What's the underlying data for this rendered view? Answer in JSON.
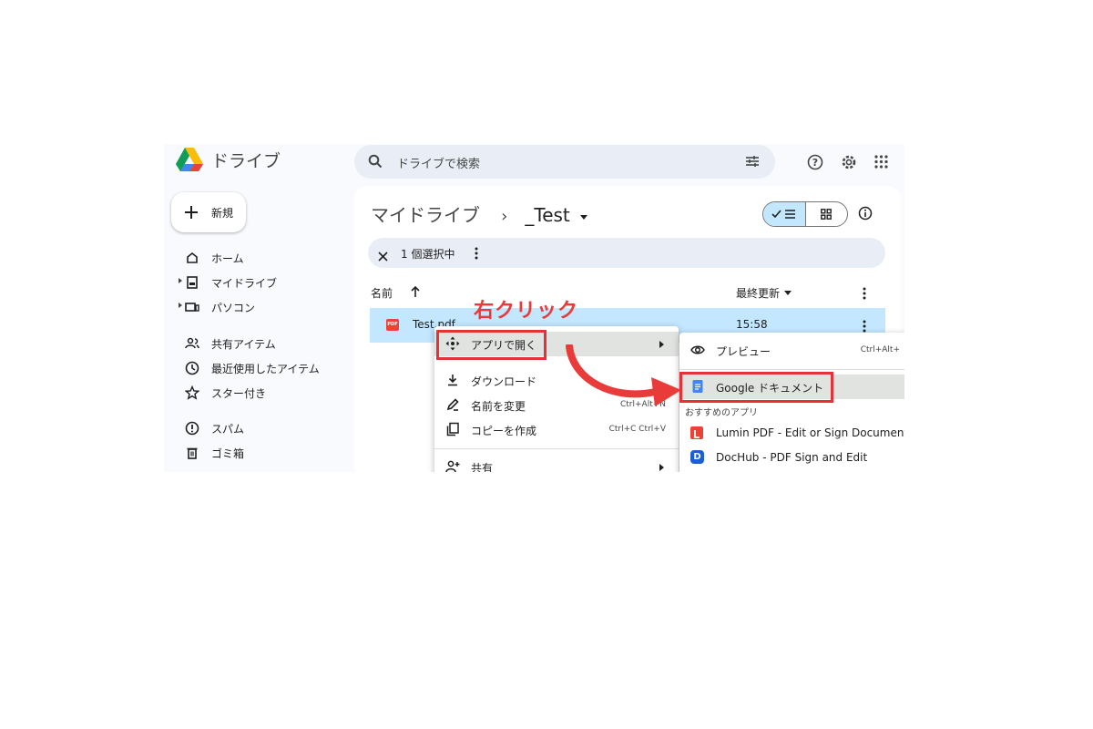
{
  "header": {
    "app_name": "ドライブ",
    "search_placeholder": "ドライブで検索"
  },
  "sidebar": {
    "new_label": "新規",
    "items": [
      {
        "label": "ホーム"
      },
      {
        "label": "マイドライブ"
      },
      {
        "label": "パソコン"
      },
      {
        "label": "共有アイテム"
      },
      {
        "label": "最近使用したアイテム"
      },
      {
        "label": "スター付き"
      },
      {
        "label": "スパム"
      },
      {
        "label": "ゴミ箱"
      }
    ]
  },
  "breadcrumb": {
    "root": "マイドライブ",
    "separator": "›",
    "current": "_Test"
  },
  "selection_bar": {
    "text": "1 個選択中"
  },
  "file_list": {
    "col_name": "名前",
    "col_modified": "最終更新",
    "rows": [
      {
        "name": "Test.pdf",
        "modified": "15:58",
        "type_badge": "PDF"
      }
    ]
  },
  "context_menu": {
    "items": [
      {
        "label": "アプリで開く",
        "shortcut": "",
        "has_submenu": true
      },
      {
        "label": "ダウンロード",
        "shortcut": ""
      },
      {
        "label": "名前を変更",
        "shortcut": "Ctrl+Alt+N"
      },
      {
        "label": "コピーを作成",
        "shortcut": "Ctrl+C Ctrl+V"
      },
      {
        "label": "共有",
        "shortcut": "",
        "has_submenu": true
      }
    ]
  },
  "submenu": {
    "preview": {
      "label": "プレビュー",
      "shortcut": "Ctrl+Alt+"
    },
    "google_docs": {
      "label": "Google ドキュメント"
    },
    "suggested_header": "おすすめのアプリ",
    "apps": [
      {
        "label": "Lumin PDF - Edit or Sign Documents"
      },
      {
        "label": "DocHub - PDF Sign and Edit"
      }
    ]
  },
  "annotation": {
    "text": "右クリック",
    "color": "#ea3b3b"
  },
  "colors": {
    "accent": "#0b57d0",
    "selected_row": "#c2e7ff",
    "highlight_box": "#e53238"
  }
}
